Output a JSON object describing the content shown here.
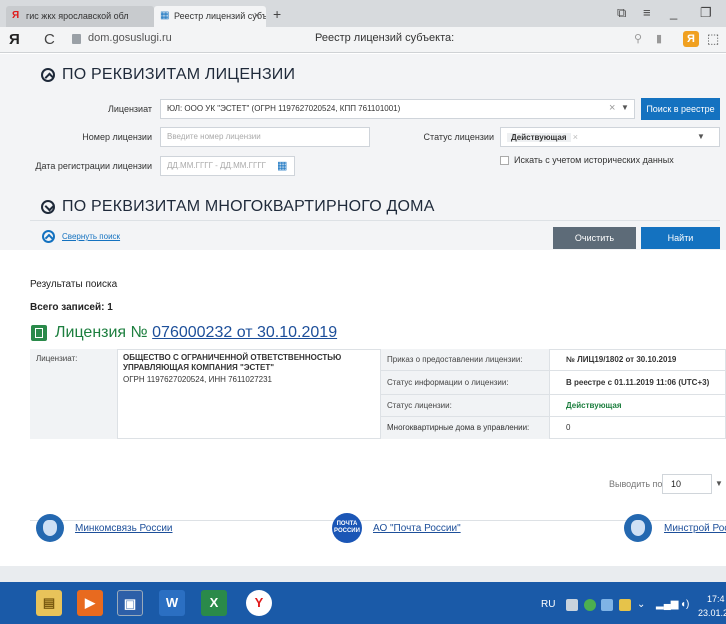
{
  "browser": {
    "tabs": [
      {
        "label": "гис жкх ярославской обл"
      },
      {
        "label": "Реестр лицензий субъе"
      }
    ],
    "new_tab": "+",
    "yandex_letter": "Я",
    "reload_glyph": "C",
    "domain": "dom.gosuslugi.ru",
    "page_title": "Реестр лицензий субъекта:"
  },
  "license_section": {
    "title": "ПО РЕКВИЗИТАМ ЛИЦЕНЗИИ",
    "licensee_label": "Лицензиат",
    "licensee_value": "ЮЛ: ООО УК \"ЭСТЕТ\" (ОГРН 1197627020524, КПП 761101001)",
    "registry_search_button": "Поиск в реестре",
    "license_number_label": "Номер лицензии",
    "license_number_placeholder": "Введите номер лицензии",
    "license_status_label": "Статус лицензии",
    "license_status_value": "Действующая",
    "registration_date_label": "Дата регистрации лицензии",
    "registration_date_placeholder": "ДД.ММ.ГГГГ - ДД.ММ.ГГГГ",
    "history_checkbox_label": "Искать с учетом исторических данных"
  },
  "house_section": {
    "title": "ПО РЕКВИЗИТАМ МНОГОКВАРТИРНОГО ДОМА"
  },
  "search_controls": {
    "collapse_link": "Свернуть поиск",
    "clear_button": "Очистить",
    "find_button": "Найти"
  },
  "results": {
    "heading": "Результаты поиска",
    "total_records": "Всего записей: 1",
    "license_prefix": "Лицензия №",
    "license_number_link": "076000232 от 30.10.2019",
    "table": {
      "licensee_label": "Лицензиат:",
      "org_name": "ОБЩЕСТВО С ОГРАНИЧЕННОЙ ОТВЕТСТВЕННОСТЬЮ УПРАВЛЯЮЩАЯ КОМПАНИЯ \"ЭСТЕТ\"",
      "org_details": "ОГРН 1197627020524, ИНН 7611027231",
      "rows": [
        {
          "label": "Приказ о предоставлении лицензии:",
          "value": "№ ЛИЦ19/1802 от 30.10.2019"
        },
        {
          "label": "Статус информации о лицензии:",
          "value": "В реестре с 01.11.2019 11:06 (UTC+3)"
        },
        {
          "label": "Статус лицензии:",
          "value": "Действующая"
        },
        {
          "label": "Многоквартирные дома в управлении:",
          "value": "0"
        }
      ]
    },
    "page_size_label": "Выводить по",
    "page_size_value": "10"
  },
  "footer": {
    "links": [
      "Минкомсвязь России",
      "АО \"Почта России\"",
      "Минстрой Росси"
    ],
    "pochta_logo": "ПОЧТА РОССИИ"
  },
  "taskbar": {
    "language": "RU",
    "time": "17:4",
    "date": "23.01.2"
  },
  "colors": {
    "accent_blue": "#1472c0",
    "status_green": "#1d7f3f",
    "taskbar_blue": "#1a5aa8"
  }
}
